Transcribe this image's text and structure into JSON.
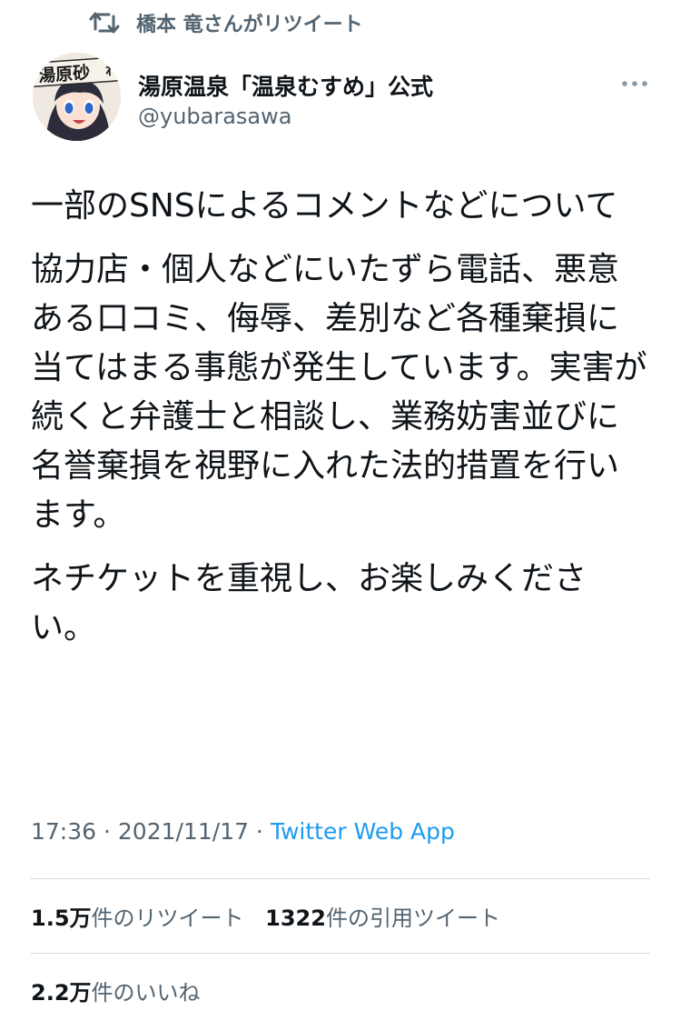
{
  "retweet_context": {
    "icon": "retweet-icon",
    "text": "橋本 竜さんがリツイート"
  },
  "author": {
    "display_name": "湯原温泉「温泉むすめ」公式",
    "handle": "@yubarasawa",
    "avatar_text": "湯原砂",
    "avatar_text_2": "れ"
  },
  "tweet": {
    "paragraphs": [
      "一部のSNSによるコメントなどについて",
      "協力店・個人などにいたずら電話、悪意ある口コミ、侮辱、差別など各種棄損に当てはまる事態が発生しています。実害が続くと弁護士と相談し、業務妨害並びに名誉棄損を視野に入れた法的措置を行います。",
      "ネチケットを重視し、お楽しみください。"
    ],
    "time": "17:36",
    "separator": " · ",
    "date": "2021/11/17",
    "source": "Twitter Web App"
  },
  "stats": {
    "retweets_count": "1.5万",
    "retweets_label": "件のリツイート",
    "quotes_count": "1322",
    "quotes_label": "件の引用ツイート",
    "likes_count": "2.2万",
    "likes_label": "件のいいね"
  },
  "colors": {
    "secondary_text": "#536471",
    "link": "#1d9bf0",
    "divider": "#cfd9de"
  }
}
